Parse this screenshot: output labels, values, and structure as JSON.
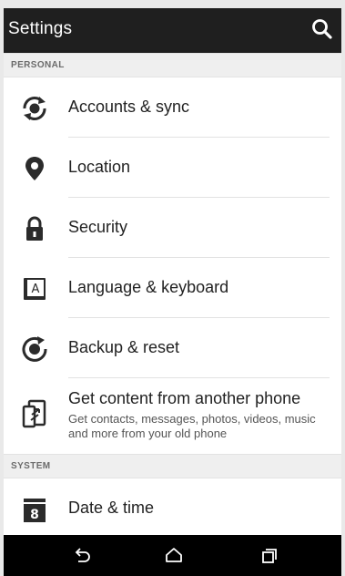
{
  "app_bar": {
    "title": "Settings",
    "search_icon": "search-icon"
  },
  "sections": {
    "personal": "PERSONAL",
    "system": "SYSTEM"
  },
  "items": {
    "accounts": {
      "label": "Accounts & sync",
      "icon": "sync-icon"
    },
    "location": {
      "label": "Location",
      "icon": "location-pin-icon"
    },
    "security": {
      "label": "Security",
      "icon": "lock-icon"
    },
    "language": {
      "label": "Language & keyboard",
      "icon": "keyboard-letter-icon",
      "glyph": "A"
    },
    "backup": {
      "label": "Backup & reset",
      "icon": "backup-reset-icon"
    },
    "transfer": {
      "label": "Get content from another phone",
      "sub": "Get contacts, messages, photos, videos, music and more from your old phone",
      "icon": "phone-transfer-icon"
    },
    "datetime": {
      "label": "Date & time",
      "icon": "calendar-icon",
      "glyph": "8"
    }
  },
  "nav": {
    "back": "back-icon",
    "home": "home-icon",
    "recents": "recents-icon"
  },
  "colors": {
    "app_bar": "#1f1f1f",
    "section_bg": "#efefef",
    "icon": "#2b2b2b",
    "nav_bar": "#000000"
  }
}
